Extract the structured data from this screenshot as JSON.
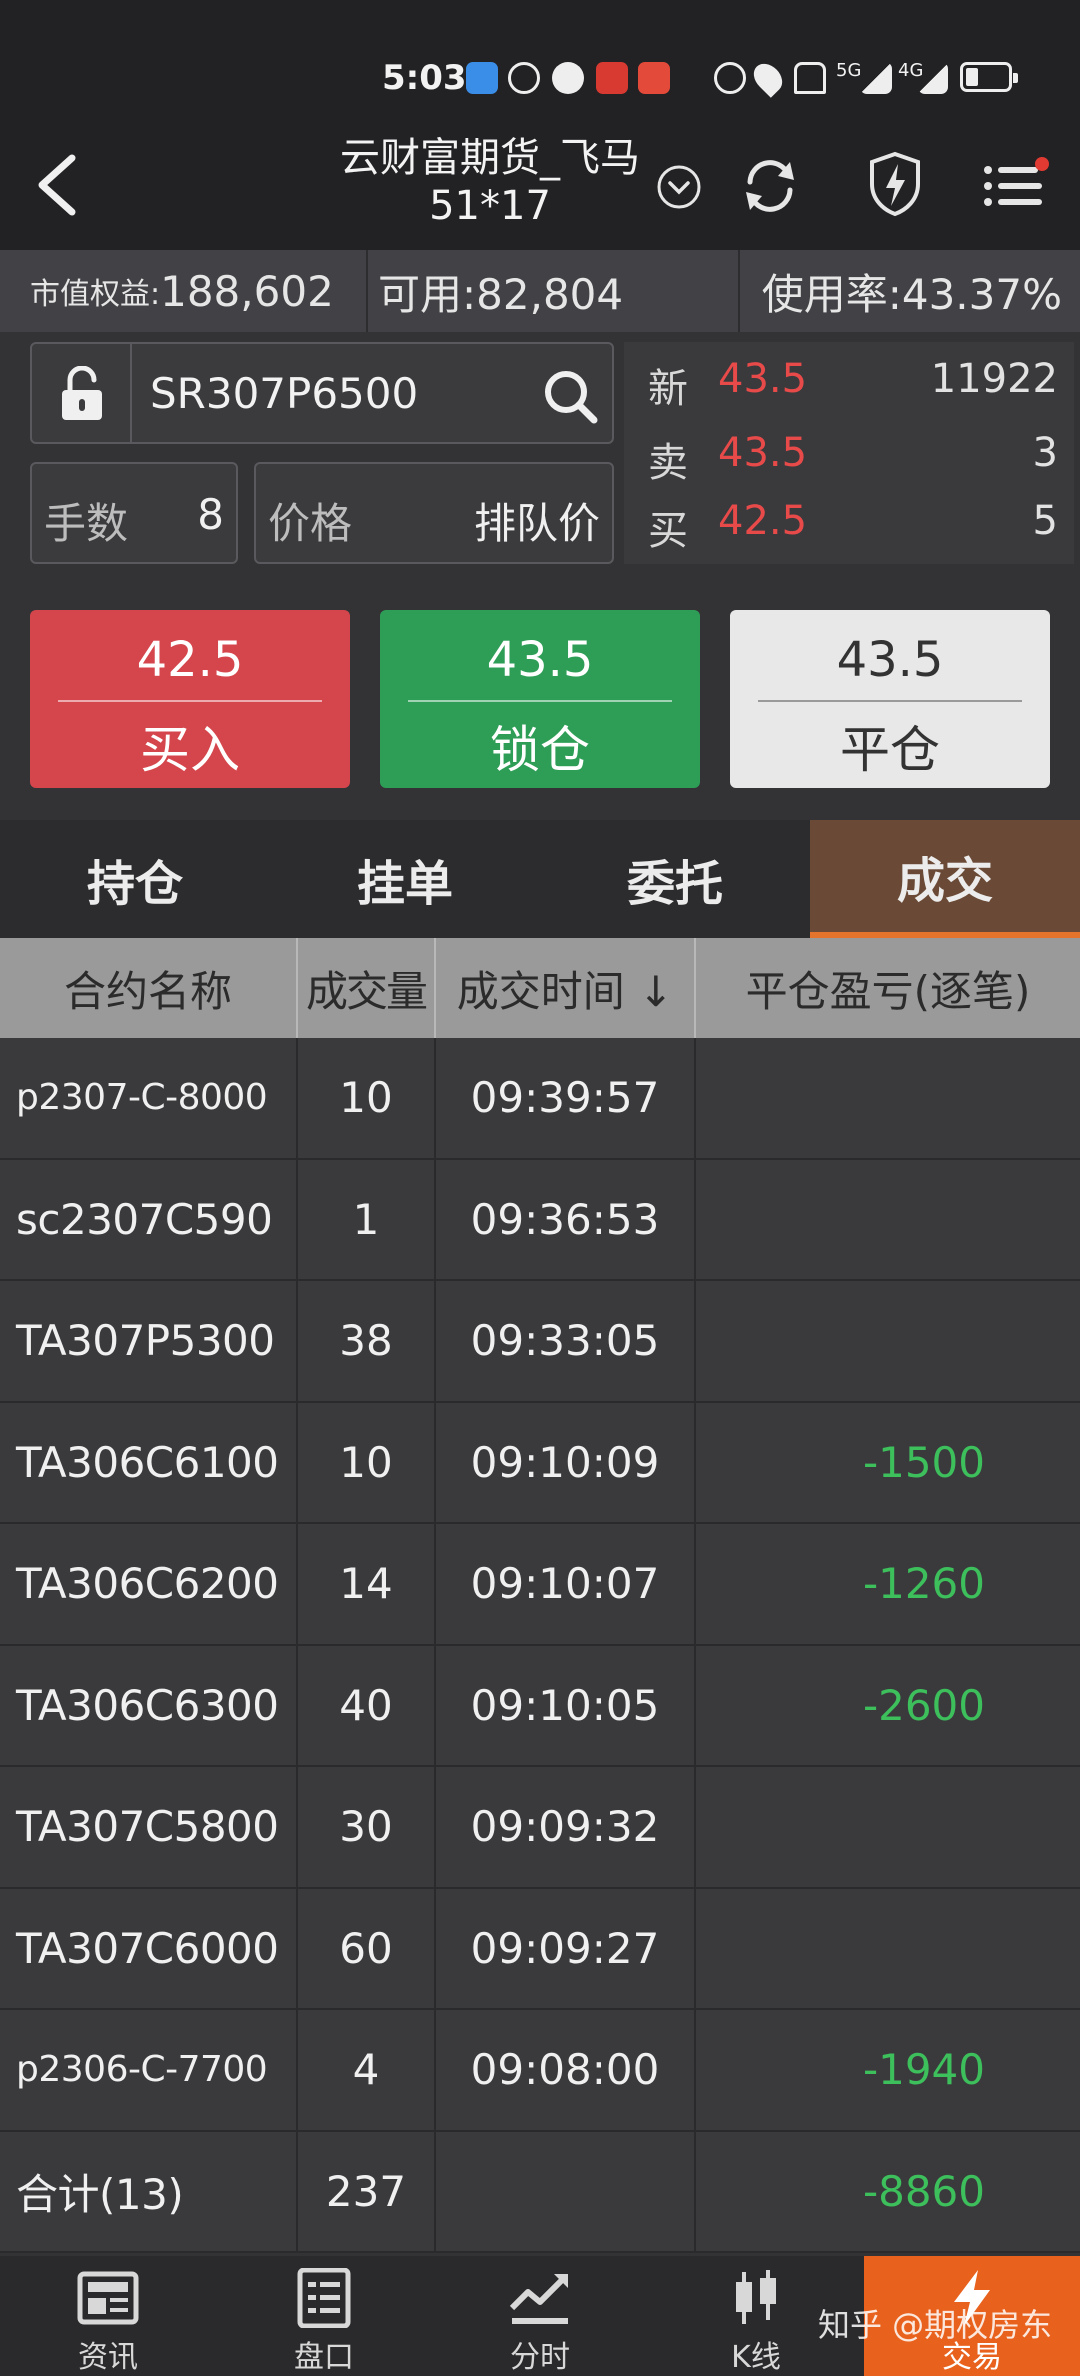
{
  "status_bar": {
    "time": "5:03",
    "network_5g": "5G",
    "network_4g": "4G"
  },
  "header": {
    "title_line1": "云财富期货_飞马",
    "title_line2": "51*17"
  },
  "account": {
    "equity_label": "市值权益:",
    "equity_value": "188,602",
    "available": "可用:82,804",
    "usage": "使用率:43.37%"
  },
  "order": {
    "contract_code": "SR307P6500",
    "lots_label": "手数",
    "lots_value": "8",
    "price_label": "价格",
    "price_value": "排队价"
  },
  "quote": {
    "last_label": "新",
    "last_price": "43.5",
    "last_volume": "11922",
    "ask_label": "卖",
    "ask_price": "43.5",
    "ask_volume": "3",
    "bid_label": "买",
    "bid_price": "42.5",
    "bid_volume": "5"
  },
  "actions": {
    "buy_price": "42.5",
    "buy_label": "买入",
    "lock_price": "43.5",
    "lock_label": "锁仓",
    "close_price": "43.5",
    "close_label": "平仓"
  },
  "tabs": [
    "持仓",
    "挂单",
    "委托",
    "成交"
  ],
  "table": {
    "headers": [
      "合约名称",
      "成交量",
      "成交时间 ↓",
      "平仓盈亏(逐笔)"
    ],
    "rows": [
      {
        "name": "p2307-C-8000",
        "qty": "10",
        "time": "09:39:57",
        "pnl": ""
      },
      {
        "name": "sc2307C590",
        "qty": "1",
        "time": "09:36:53",
        "pnl": ""
      },
      {
        "name": "TA307P5300",
        "qty": "38",
        "time": "09:33:05",
        "pnl": ""
      },
      {
        "name": "TA306C6100",
        "qty": "10",
        "time": "09:10:09",
        "pnl": "-1500"
      },
      {
        "name": "TA306C6200",
        "qty": "14",
        "time": "09:10:07",
        "pnl": "-1260"
      },
      {
        "name": "TA306C6300",
        "qty": "40",
        "time": "09:10:05",
        "pnl": "-2600"
      },
      {
        "name": "TA307C5800",
        "qty": "30",
        "time": "09:09:32",
        "pnl": ""
      },
      {
        "name": "TA307C6000",
        "qty": "60",
        "time": "09:09:27",
        "pnl": ""
      },
      {
        "name": "p2306-C-7700",
        "qty": "4",
        "time": "09:08:00",
        "pnl": "-1940"
      }
    ],
    "total": {
      "name": "合计(13)",
      "qty": "237",
      "time": "",
      "pnl": "-8860"
    }
  },
  "bottom_nav": [
    "资讯",
    "盘口",
    "分时",
    "K线",
    "交易"
  ],
  "watermark": "知乎 @期权房东",
  "colors": {
    "buy": "#d5454c",
    "lock": "#2e9e57",
    "close": "#e8e8e8",
    "loss_green": "#3dbf5c",
    "price_red": "#e84a4a",
    "active_tab": "#e4732c",
    "active_nav": "#e8621e"
  },
  "icons": [
    "back-icon",
    "chevron-down-icon",
    "refresh-icon",
    "shield-bolt-icon",
    "menu-icon",
    "unlock-icon",
    "search-icon",
    "news-icon",
    "orderbook-icon",
    "intraday-chart-icon",
    "candlestick-icon",
    "lightning-icon"
  ]
}
